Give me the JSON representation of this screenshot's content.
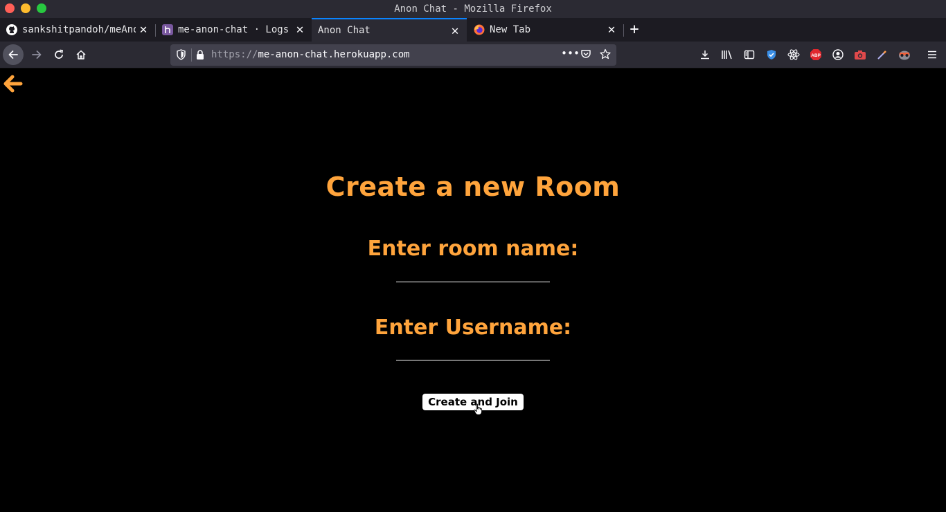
{
  "window": {
    "title": "Anon Chat - Mozilla Firefox"
  },
  "tabs": [
    {
      "label": "sankshitpandoh/meAnonCh",
      "favicon": "github-icon"
    },
    {
      "label": "me-anon-chat · Logs",
      "favicon": "heroku-icon"
    },
    {
      "label": "Anon Chat",
      "active": true
    },
    {
      "label": "New Tab",
      "favicon": "firefox-icon"
    }
  ],
  "urlbar": {
    "protocol": "https://",
    "host": "me-anon-chat.herokuapp.com"
  },
  "toolbar_icons": [
    "download-icon",
    "library-icon",
    "sidebar-icon",
    "shield-extension-icon",
    "react-devtools-icon",
    "adblock-icon",
    "account-icon",
    "screenshot-icon",
    "color-picker-icon",
    "privacy-badger-icon",
    "menu-icon"
  ],
  "main": {
    "title": "Create a new Room",
    "room_label": "Enter room name:",
    "room_value": "",
    "username_label": "Enter Username:",
    "username_value": "",
    "submit_label": "Create and Join"
  },
  "colors": {
    "accent": "#ffa43c",
    "background": "#000000",
    "active_tab_line": "#0a84ff"
  }
}
